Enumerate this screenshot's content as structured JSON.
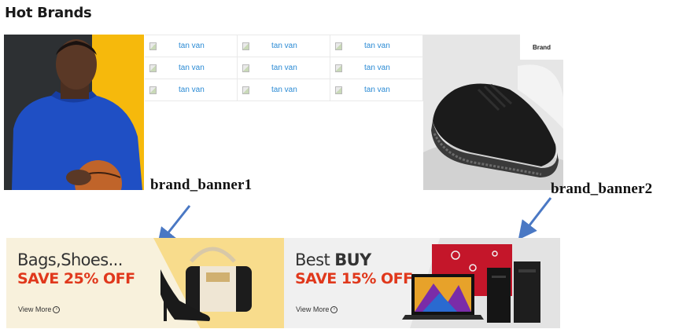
{
  "section": {
    "title": "Hot Brands"
  },
  "brand_grid": {
    "cells": [
      {
        "label": "tan van"
      },
      {
        "label": "tan van"
      },
      {
        "label": "tan van"
      },
      {
        "label": "tan van"
      },
      {
        "label": "tan van"
      },
      {
        "label": "tan van"
      },
      {
        "label": "tan van"
      },
      {
        "label": "tan van"
      },
      {
        "label": "tan van"
      }
    ]
  },
  "shoe_image": {
    "tag": "Brand"
  },
  "annotations": {
    "banner1": "brand_banner1",
    "banner2": "brand_banner2"
  },
  "banner1": {
    "line1": "Bags,Shoes...",
    "line2": "SAVE 25% OFF",
    "link": "View More"
  },
  "banner2": {
    "line1_prefix": "Best ",
    "line1_bold": "BUY",
    "line2": "SAVE 15% OFF",
    "link": "View More"
  },
  "colors": {
    "accent": "#e0381c",
    "link": "#2a8ad4",
    "arrow": "#4a78c4",
    "yellow": "#f6b90c"
  }
}
